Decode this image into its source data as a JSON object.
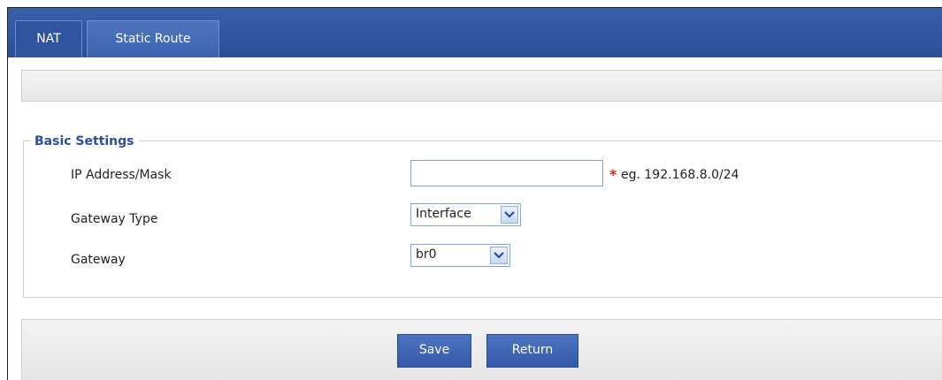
{
  "tabs": [
    {
      "label": "NAT",
      "active": false
    },
    {
      "label": "Static Route",
      "active": true
    }
  ],
  "form": {
    "section_title": "Basic Settings",
    "ip_mask": {
      "label": "IP Address/Mask",
      "value": "",
      "required": "*",
      "hint": "eg. 192.168.8.0/24"
    },
    "gateway_type": {
      "label": "Gateway Type",
      "selected": "Interface"
    },
    "gateway": {
      "label": "Gateway",
      "selected": "br0"
    }
  },
  "footer": {
    "save_label": "Save",
    "return_label": "Return"
  },
  "colors": {
    "header": "#2b4f98",
    "legend": "#2d4f9b",
    "button": "#3d64b0",
    "required": "#e02020"
  }
}
